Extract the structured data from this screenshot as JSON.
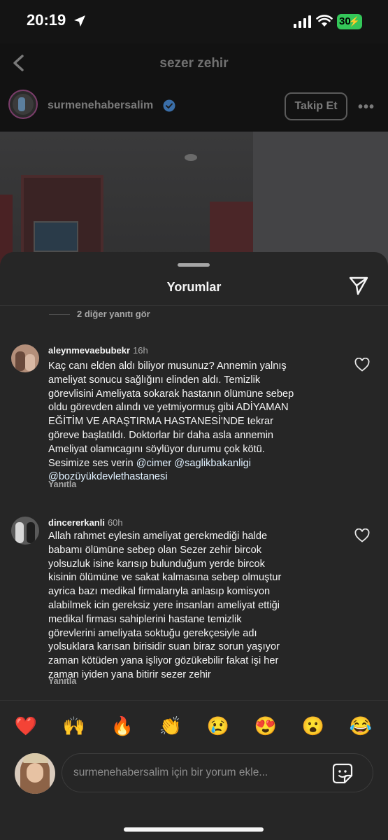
{
  "status_bar": {
    "time": "20:19",
    "battery": "30"
  },
  "header": {
    "title": "sezer zehir"
  },
  "post": {
    "username": "surmenehabersalim",
    "follow_label": "Takip Et",
    "more": "•••"
  },
  "sheet": {
    "title": "Yorumlar",
    "view_replies": "2 diğer yanıtı gör",
    "comments": [
      {
        "username": "aleynmevaebubekr",
        "time": "16h",
        "text": "Kaç canı elden aldı biliyor musunuz? Annemin yalnış\nameliyat sonucu sağlığını elinden aldı. Temizlik\ngörevlisini Ameliyata sokarak hastanın ölümüne sebep\noldu görevden alındı ve yetmiyormuş gibi ADİYAMAN\nEĞİTİM VE ARAŞTIRMA HASTANESİ'NDE tekrar\ngöreve başlatıldı. Doktorlar bir daha asla annemin\nAmeliyat olamıcagını söylüyor durumu çok kötü.\nSesimize ses verin ",
        "mentions": [
          "@cimer",
          "@saglikbakanligi",
          "@bozüyükdevlethastanesi"
        ],
        "reply": "Yanıtla"
      },
      {
        "username": "dincererkanli",
        "time": "60h",
        "text": "Allah rahmet eylesin ameliyat gerekmediği halde\nbabamı ölümüne sebep olan Sezer zehir bircok\nyolsuzluk isine karısıp bulunduğum yerde bircok\nkisinin ölümüne ve sakat kalmasına sebep olmuştur\nayrica bazı medikal firmalarıyla anlasıp komisyon\nalabilmek icin gereksiz yere insanları ameliyat ettiği\nmedikal firması sahiplerini hastane temizlik\ngörevlerini ameliyata soktuğu gerekçesiyle adı\nyolsuklara karısan birisidir suan biraz sorun yaşıyor\nzaman kötüden yana işliyor gözükebilir fakat işi her\nzaman iyiden yana bitirir sezer zehir",
        "reply": "Yanıtla"
      }
    ],
    "emojis": [
      "❤️",
      "🙌",
      "🔥",
      "👏",
      "😢",
      "😍",
      "😮",
      "😂"
    ],
    "composer_placeholder": "surmenehabersalim için bir yorum ekle..."
  }
}
